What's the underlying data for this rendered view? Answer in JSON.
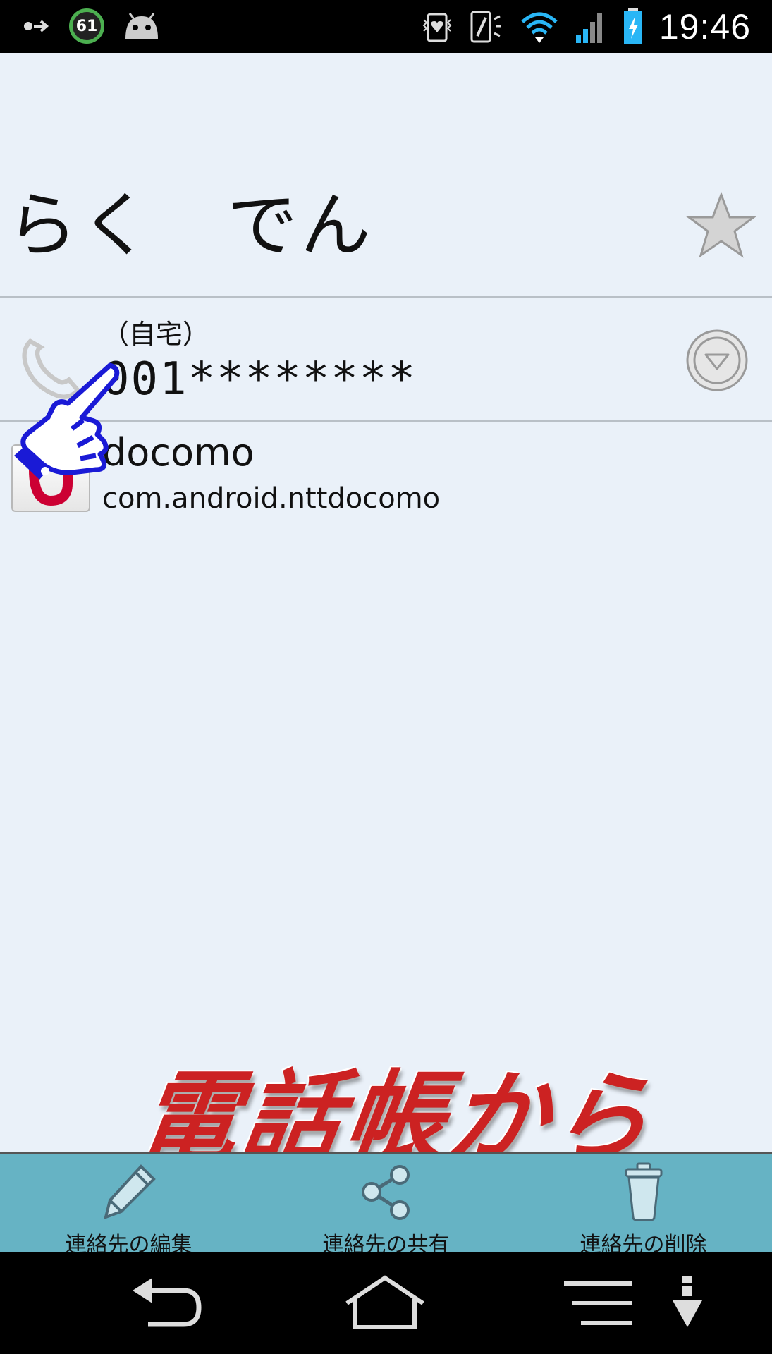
{
  "status_bar": {
    "time": "19:46",
    "notification_count": "61",
    "icons": [
      "arrow-dot-icon",
      "counter-badge-icon",
      "android-icon",
      "vibrate-heart-icon",
      "nfc-phone-icon",
      "wifi-icon",
      "signal-icon",
      "battery-charging-icon"
    ]
  },
  "contact": {
    "name": "らく　でん",
    "favorite_icon": "star-icon"
  },
  "phone": {
    "type": "（自宅）",
    "number": "001********"
  },
  "account": {
    "name": "docomo",
    "package": "com.android.nttdocomo"
  },
  "promo_text": "電話帳から",
  "actions": [
    {
      "label": "連絡先の編集",
      "icon": "pencil-icon"
    },
    {
      "label": "連絡先の共有",
      "icon": "share-icon"
    },
    {
      "label": "連絡先の削除",
      "icon": "trash-icon"
    }
  ],
  "nav": [
    "back-icon",
    "home-icon",
    "menu-icon",
    "download-icon"
  ],
  "colors": {
    "background": "#eaf1f9",
    "action_bar": "#66b3c4",
    "promo": "#cc2222",
    "hand_outline": "#1a1ad6"
  }
}
